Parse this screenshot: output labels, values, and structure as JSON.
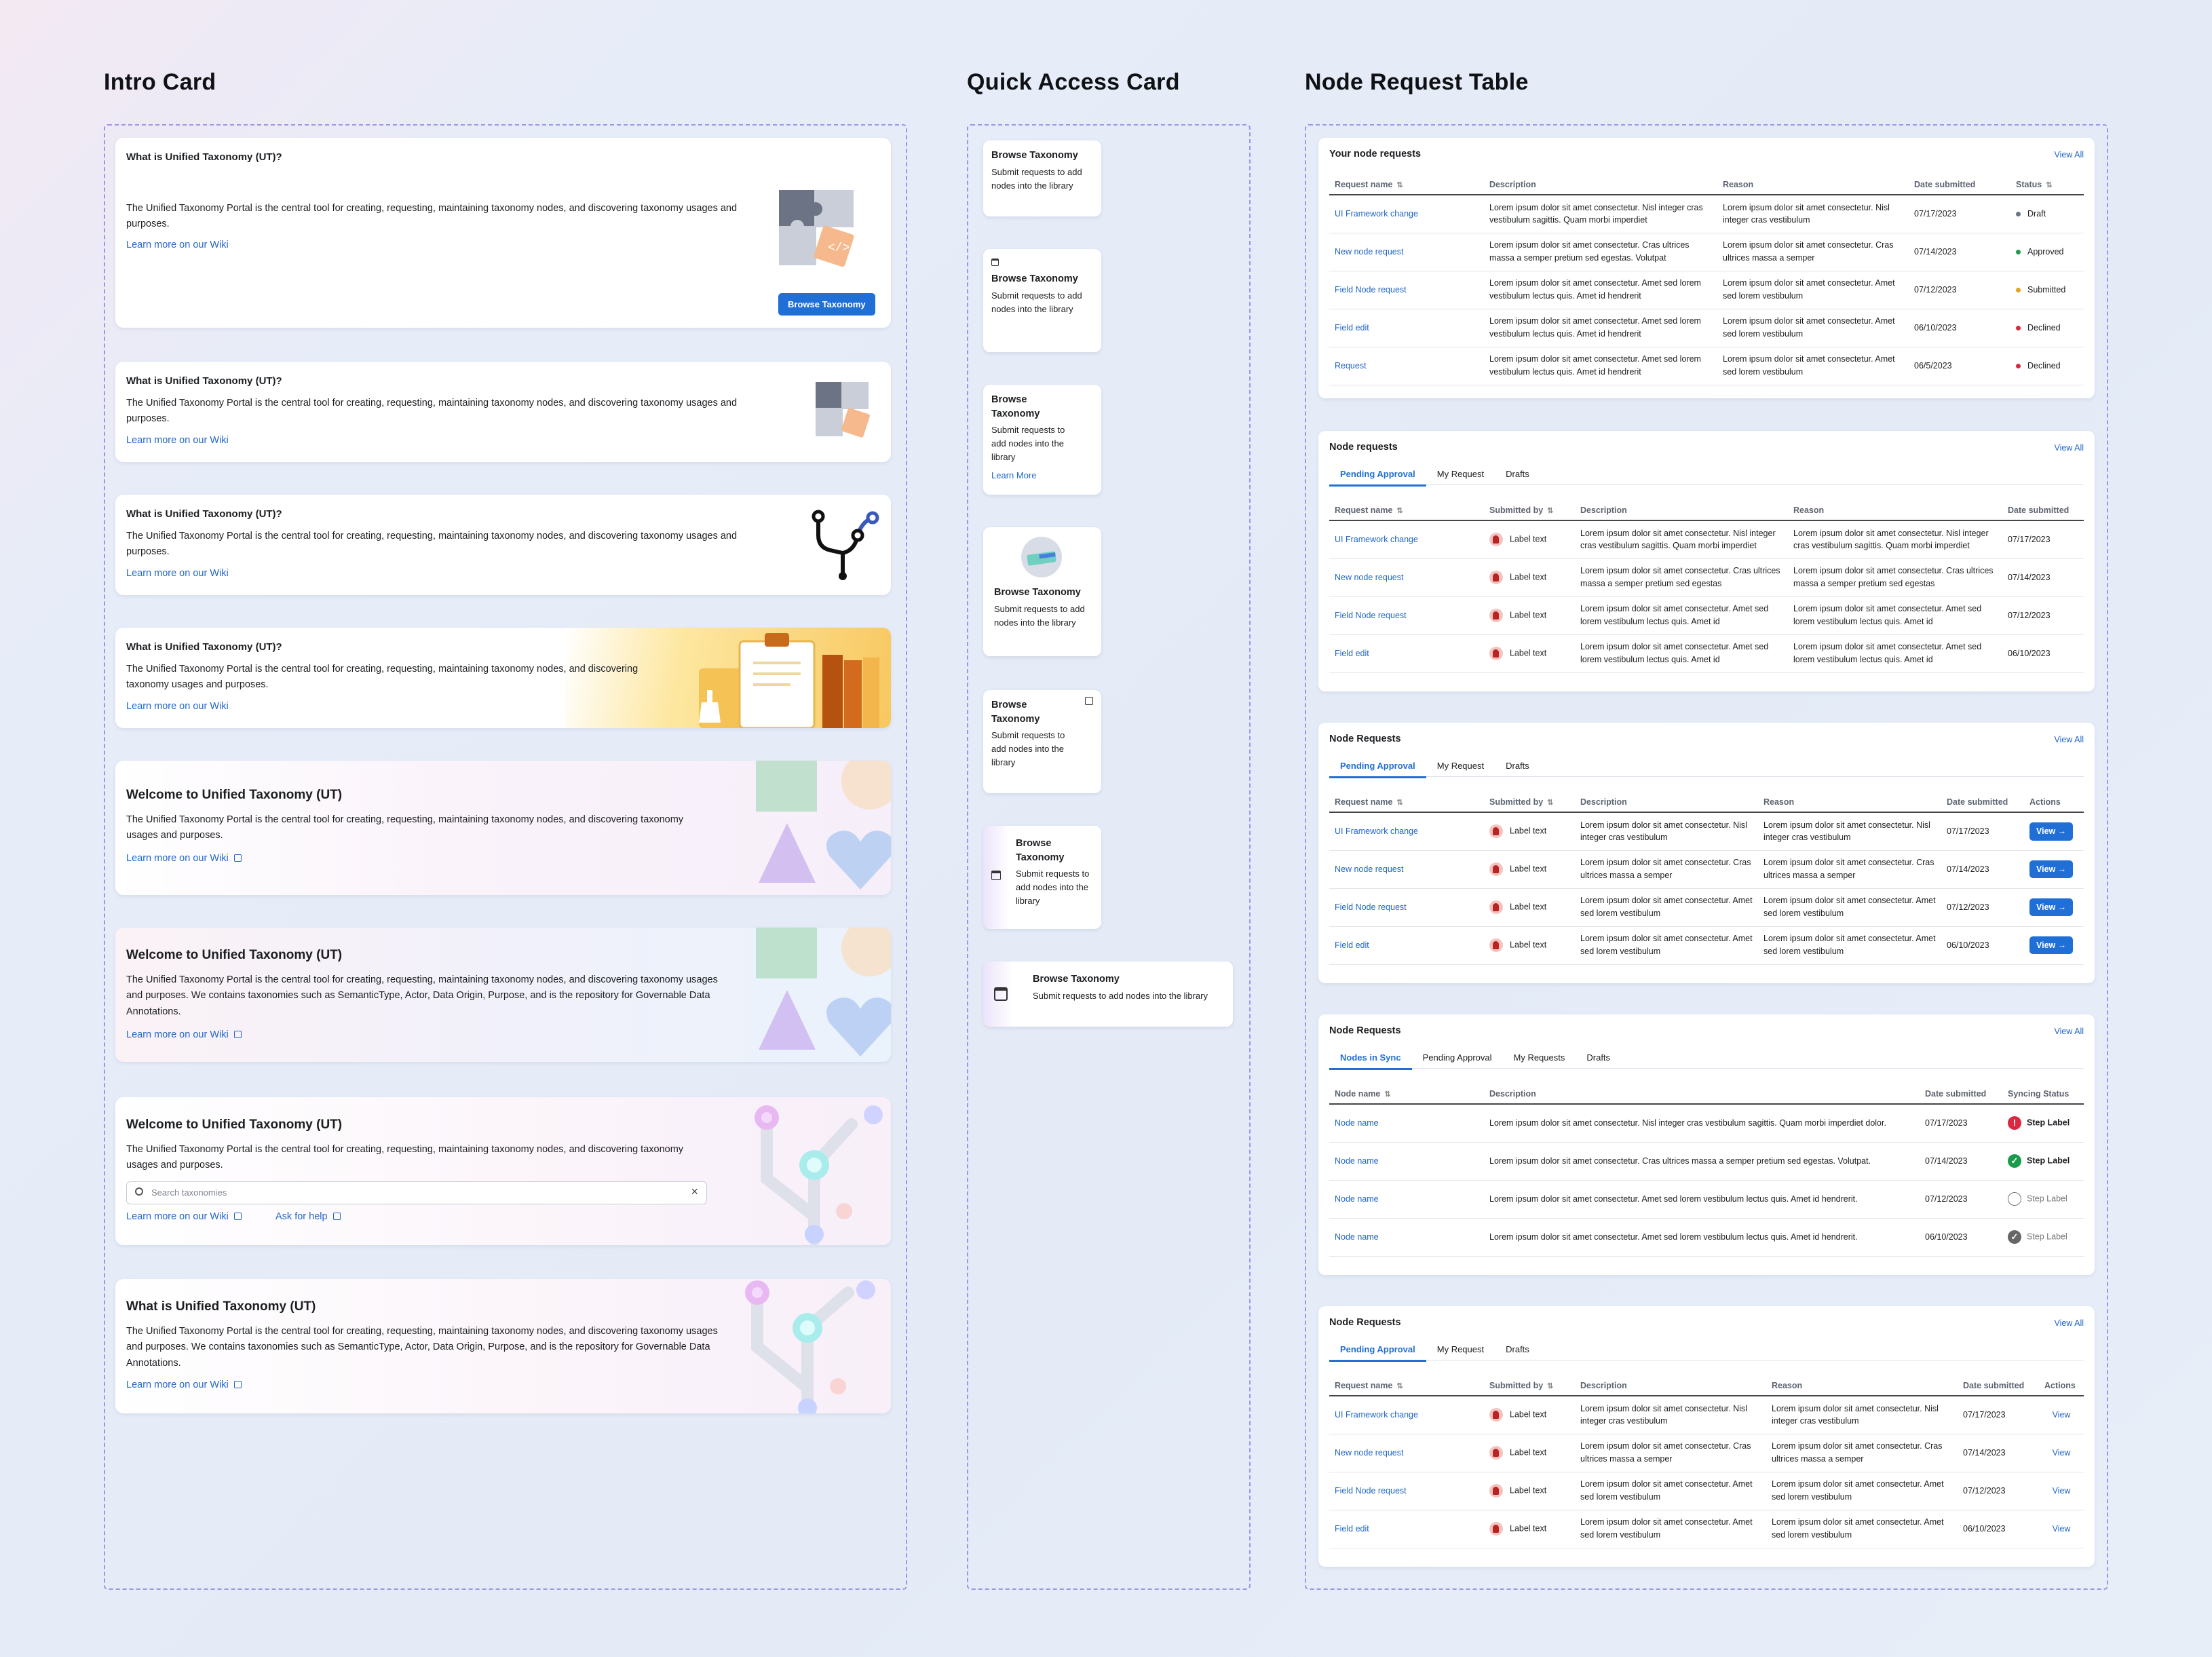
{
  "sections": {
    "intro": "Intro Card",
    "quick": "Quick Access Card",
    "table": "Node Request Table"
  },
  "intro": {
    "q": "What is Unified Taxonomy (UT)?",
    "q2": "What is Unified Taxonomy (UT)",
    "welcome": "Welcome to Unified Taxonomy (UT)",
    "body": "The Unified Taxonomy Portal is the central tool for creating, requesting, maintaining taxonomy nodes, and discovering taxonomy usages and purposes.",
    "body_long": "The Unified Taxonomy Portal is the central tool for creating, requesting, maintaining taxonomy nodes, and discovering taxonomy usages and purposes. We contains taxonomies such as SemanticType, Actor, Data Origin, Purpose, and is the repository for Governable Data Annotations.",
    "wiki": "Learn more on our Wiki",
    "help": "Ask for help",
    "browse_btn": "Browse Taxonomy",
    "search_placeholder": "Search taxonomies"
  },
  "quick": {
    "title": "Browse Taxonomy",
    "desc": "Submit requests to add nodes into the library",
    "learn": "Learn More"
  },
  "table": {
    "view_all": "View All",
    "your_title": "Your node requests",
    "t2_title": "Node requests",
    "t3_title": "Node Requests",
    "cols": {
      "req": "Request name",
      "desc": "Description",
      "reason": "Reason",
      "date": "Date submitted",
      "status": "Status",
      "sub": "Submitted by",
      "actions": "Actions",
      "node": "Node name",
      "sync": "Syncing Status"
    },
    "tabs": [
      "Pending Approval",
      "My Request",
      "Drafts"
    ],
    "tabs4": [
      "Nodes in Sync",
      "Pending Approval",
      "My Requests",
      "Drafts"
    ],
    "label": "Label text",
    "view": "View",
    "your_rows": [
      {
        "name": "UI Framework change",
        "desc": "Lorem ipsum dolor sit amet consectetur. Nisl integer cras vestibulum sagittis. Quam morbi imperdiet",
        "reason": "Lorem ipsum dolor sit amet consectetur. Nisl integer cras vestibulum",
        "date": "07/17/2023",
        "status": "Draft",
        "color": "#6b7280"
      },
      {
        "name": "New node request",
        "desc": "Lorem ipsum dolor sit amet consectetur. Cras ultrices massa a semper pretium sed egestas. Volutpat",
        "reason": "Lorem ipsum dolor sit amet consectetur. Cras ultrices massa a semper",
        "date": "07/14/2023",
        "status": "Approved",
        "color": "#1a9a4b"
      },
      {
        "name": "Field Node request",
        "desc": "Lorem ipsum dolor sit amet consectetur. Amet sed lorem vestibulum lectus quis. Amet id hendrerit",
        "reason": "Lorem ipsum dolor sit amet consectetur. Amet sed lorem vestibulum",
        "date": "07/12/2023",
        "status": "Submitted",
        "color": "#e5a21b"
      },
      {
        "name": "Field edit",
        "desc": "Lorem ipsum dolor sit amet consectetur. Amet sed lorem vestibulum lectus quis. Amet id hendrerit",
        "reason": "Lorem ipsum dolor sit amet consectetur. Amet sed lorem vestibulum",
        "date": "06/10/2023",
        "status": "Declined",
        "color": "#d9283f"
      },
      {
        "name": "Request",
        "desc": "Lorem ipsum dolor sit amet consectetur. Amet sed lorem vestibulum lectus quis. Amet id hendrerit",
        "reason": "Lorem ipsum dolor sit amet consectetur. Amet sed lorem vestibulum",
        "date": "06/5/2023",
        "status": "Declined",
        "color": "#d9283f"
      }
    ],
    "req_rows": [
      {
        "name": "UI Framework change",
        "desc": "Lorem ipsum dolor sit amet consectetur. Nisl integer cras vestibulum sagittis. Quam morbi imperdiet",
        "reason": "Lorem ipsum dolor sit amet consectetur. Nisl integer cras vestibulum sagittis. Quam morbi imperdiet",
        "date": "07/17/2023"
      },
      {
        "name": "New node request",
        "desc": "Lorem ipsum dolor sit amet consectetur. Cras ultrices massa a semper pretium sed egestas",
        "reason": "Lorem ipsum dolor sit amet consectetur. Cras ultrices massa a semper pretium sed egestas",
        "date": "07/14/2023"
      },
      {
        "name": "Field Node request",
        "desc": "Lorem ipsum dolor sit amet consectetur. Amet sed lorem vestibulum lectus quis. Amet id",
        "reason": "Lorem ipsum dolor sit amet consectetur. Amet sed lorem vestibulum lectus quis. Amet id",
        "date": "07/12/2023"
      },
      {
        "name": "Field edit",
        "desc": "Lorem ipsum dolor sit amet consectetur. Amet sed lorem vestibulum lectus quis. Amet id",
        "reason": "Lorem ipsum dolor sit amet consectetur. Amet sed lorem vestibulum lectus quis. Amet id",
        "date": "06/10/2023"
      }
    ],
    "req_rows_b": [
      {
        "name": "UI Framework change",
        "desc": "Lorem ipsum dolor sit amet consectetur. Nisl integer cras vestibulum",
        "reason": "Lorem ipsum dolor sit amet consectetur. Nisl integer cras vestibulum",
        "date": "07/17/2023"
      },
      {
        "name": "New node request",
        "desc": "Lorem ipsum dolor sit amet consectetur. Cras ultrices massa a semper",
        "reason": "Lorem ipsum dolor sit amet consectetur. Cras ultrices massa a semper",
        "date": "07/14/2023"
      },
      {
        "name": "Field Node request",
        "desc": "Lorem ipsum dolor sit amet consectetur. Amet sed lorem vestibulum",
        "reason": "Lorem ipsum dolor sit amet consectetur. Amet sed lorem vestibulum",
        "date": "07/12/2023"
      },
      {
        "name": "Field edit",
        "desc": "Lorem ipsum dolor sit amet consectetur. Amet sed lorem vestibulum",
        "reason": "Lorem ipsum dolor sit amet consectetur. Amet sed lorem vestibulum",
        "date": "06/10/2023"
      }
    ],
    "sync_rows": [
      {
        "name": "Node name",
        "desc": "Lorem ipsum dolor sit amet consectetur. Nisl integer cras vestibulum sagittis. Quam morbi imperdiet dolor.",
        "date": "07/17/2023",
        "status": "Step Label",
        "state": "error"
      },
      {
        "name": "Node name",
        "desc": "Lorem ipsum dolor sit amet consectetur. Cras ultrices massa a semper pretium sed egestas. Volutpat.",
        "date": "07/14/2023",
        "status": "Step Label",
        "state": "success"
      },
      {
        "name": "Node name",
        "desc": "Lorem ipsum dolor sit amet consectetur. Amet sed lorem vestibulum lectus quis. Amet id hendrerit.",
        "date": "07/12/2023",
        "status": "Step Label",
        "state": "empty"
      },
      {
        "name": "Node name",
        "desc": "Lorem ipsum dolor sit amet consectetur. Amet sed lorem vestibulum lectus quis. Amet id hendrerit.",
        "date": "06/10/2023",
        "status": "Step Label",
        "state": "done"
      }
    ]
  }
}
